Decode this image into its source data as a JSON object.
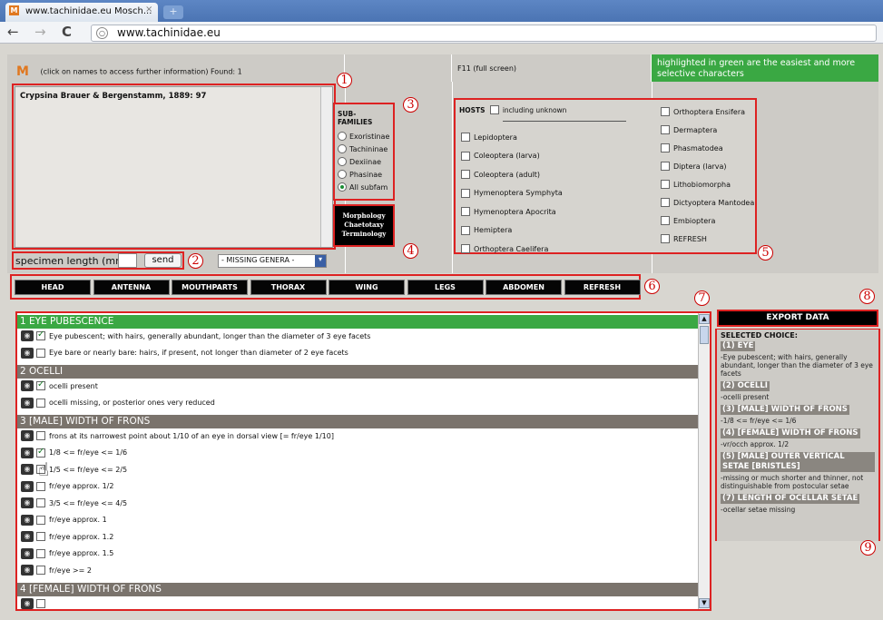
{
  "browser": {
    "tab_title": "www.tachinidae.eu Mosch...",
    "tab_close": "×",
    "tab_favicon": "M",
    "new_tab": "+",
    "url": "www.tachinidae.eu",
    "back": "←",
    "forward": "→",
    "reload": "C"
  },
  "header": {
    "logo": "M",
    "info": "(click on names to access further information) Found: 1",
    "fullscreen": "F11 (full screen)",
    "green_note": "highlighted in green are the easiest and more selective characters"
  },
  "species": {
    "name": "Crypsina Brauer & Bergenstamm, 1889: 97"
  },
  "specimen": {
    "label": "specimen length (mm):",
    "input_value": "",
    "send": "send",
    "missing_genera": "- MISSING GENERA -"
  },
  "subfamilies": {
    "title": "SUB-FAMILIES",
    "items": [
      {
        "label": "Exoristinae",
        "checked": false
      },
      {
        "label": "Tachininae",
        "checked": false
      },
      {
        "label": "Dexiinae",
        "checked": false
      },
      {
        "label": "Phasinae",
        "checked": false
      },
      {
        "label": "All subfam",
        "checked": true
      }
    ]
  },
  "morphology_button": {
    "line1": "Morphology",
    "line2": "Chaetotaxy",
    "line3": "Terminology"
  },
  "hosts": {
    "title": "HOSTS",
    "including_unknown": "including unknown",
    "col1": [
      "Lepidoptera",
      "Coleoptera (larva)",
      "Coleoptera (adult)",
      "Hymenoptera Symphyta",
      "Hymenoptera Apocrita",
      "Hemiptera",
      "Orthoptera Caelifera"
    ],
    "col2": [
      "Orthoptera Ensifera",
      "Dermaptera",
      "Phasmatodea",
      "Diptera (larva)",
      "Lithobiomorpha",
      "Dictyoptera Mantodea",
      "Embioptera",
      "REFRESH"
    ]
  },
  "char_tabs": [
    "HEAD",
    "ANTENNA",
    "MOUTHPARTS",
    "THORAX",
    "WING",
    "LEGS",
    "ABDOMEN",
    "REFRESH"
  ],
  "sections": [
    {
      "title": "1 EYE PUBESCENCE",
      "green": true,
      "options": [
        {
          "text": "Eye pubescent; with hairs, generally abundant, longer than the diameter of 3 eye facets",
          "checked": true
        },
        {
          "text": "Eye bare or nearly bare: hairs, if present, not longer than diameter of 2 eye facets",
          "checked": false
        }
      ]
    },
    {
      "title": "2 OCELLI",
      "green": false,
      "options": [
        {
          "text": "ocelli present",
          "checked": true
        },
        {
          "text": "ocelli missing, or posterior ones very reduced",
          "checked": false
        }
      ]
    },
    {
      "title": "3 [MALE] WIDTH OF FRONS",
      "green": false,
      "options": [
        {
          "text": "frons at its narrowest point about 1/10 of an eye in dorsal view [= fr/eye 1/10]",
          "checked": false
        },
        {
          "text": "1/8 <= fr/eye <= 1/6",
          "checked": true
        },
        {
          "text": "1/5 <= fr/eye <= 2/5",
          "checked": false
        },
        {
          "text": "fr/eye approx. 1/2",
          "checked": false
        },
        {
          "text": "3/5 <= fr/eye <= 4/5",
          "checked": false
        },
        {
          "text": "fr/eye approx. 1",
          "checked": false
        },
        {
          "text": "fr/eye approx. 1.2",
          "checked": false
        },
        {
          "text": "fr/eye approx. 1.5",
          "checked": false
        },
        {
          "text": "fr/eye >= 2",
          "checked": false
        }
      ]
    },
    {
      "title": "4 [FEMALE] WIDTH OF FRONS",
      "green": false,
      "options": [
        {
          "text": "",
          "checked": false
        }
      ]
    }
  ],
  "export": {
    "label": "EXPORT DATA"
  },
  "selected": {
    "title": "SELECTED CHOICE:",
    "items": [
      {
        "head": "(1) EYE",
        "text": "-Eye pubescent; with hairs, generally abundant, longer than the diameter of 3 eye facets"
      },
      {
        "head": "(2) OCELLI",
        "text": "-ocelli present"
      },
      {
        "head": "(3) [MALE] WIDTH OF FRONS",
        "text": "-1/8 <= fr/eye <= 1/6"
      },
      {
        "head": "(4) [FEMALE] WIDTH OF FRONS",
        "text": "-vr/occh approx. 1/2"
      },
      {
        "head": "(5) [MALE] OUTER VERTICAL SETAE [BRISTLES]",
        "text": "-missing or much shorter and thinner, not distinguishable from postocular setae"
      },
      {
        "head": "(7) LENGTH OF OCELLAR SETAE",
        "text": "-ocellar setae missing"
      }
    ]
  },
  "callouts": [
    "1",
    "2",
    "3",
    "4",
    "5",
    "6",
    "7",
    "8",
    "9"
  ],
  "colors": {
    "green": "#3aa843",
    "red_outline": "#dd2222",
    "section_grey": "#7a736c"
  }
}
